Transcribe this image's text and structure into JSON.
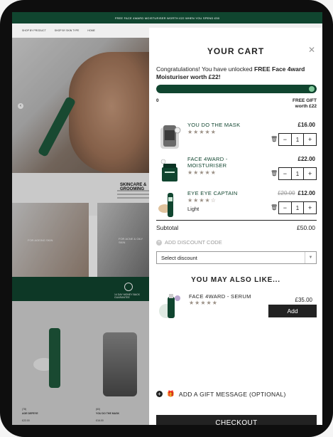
{
  "banner": {
    "text": "FREE FACE 4WARD MOISTURISER WORTH £22 WHEN YOU SPEND £50"
  },
  "nav": {
    "items": [
      "SHOP BY PRODUCT",
      "SHOP BY SKIN TYPE",
      "HOME"
    ]
  },
  "background": {
    "skincare_heading": "SKINCARE & GROOMING",
    "tile1_caption": "FOR AGEING SKIN",
    "tile2_caption": "FOR ACNE & OILY SKIN",
    "guarantee": "14 DAY MONEY BACK GUARANTEE",
    "product1": {
      "reviews": "(78)",
      "name": "AGE DEFEYE",
      "price": "£22.00"
    },
    "product2": {
      "reviews": "(60)",
      "name": "YOU DO THE MASK",
      "price": "£16.00"
    }
  },
  "cart": {
    "title": "YOUR CART",
    "close_icon": "close-icon",
    "congrats_prefix": "Congratulations! You have unlocked ",
    "congrats_bold": "FREE Face 4ward Moisturiser worth £22!",
    "progress_fraction": 1.0,
    "progress_start_label": "0",
    "progress_end_label": "FREE GIFT worth £22",
    "items": [
      {
        "name": "YOU DO THE MASK",
        "stars": "★★★★★",
        "price": "£16.00",
        "old_price": "",
        "variant": "",
        "qty": "1"
      },
      {
        "name": "FACE 4WARD - MOISTURISER",
        "stars": "★★★★★",
        "price": "£22.00",
        "old_price": "",
        "variant": "",
        "qty": "1"
      },
      {
        "name": "EYE EYE CAPTAIN",
        "stars": "★★★★☆",
        "price": "£12.00",
        "old_price": "£20.00",
        "variant": "Light",
        "qty": "1"
      }
    ],
    "stepper_minus": "−",
    "stepper_plus": "+",
    "trash_icon": "trash-icon",
    "subtotal_label": "Subtotal",
    "subtotal_value": "£50.00",
    "discount_label": "ADD DISCOUNT CODE",
    "discount_select": "Select discount",
    "upsell_heading": "YOU MAY ALSO LIKE...",
    "upsell": {
      "name": "FACE 4WARD - SERUM",
      "stars": "★★★★★",
      "price": "£35.00",
      "add_label": "Add"
    },
    "gift_message": "ADD A GIFT MESSAGE (OPTIONAL)",
    "checkout_label": "CHECKOUT",
    "colors": {
      "brand_green": "#10452f",
      "dark": "#222222",
      "stars": "#9a8f84"
    }
  }
}
